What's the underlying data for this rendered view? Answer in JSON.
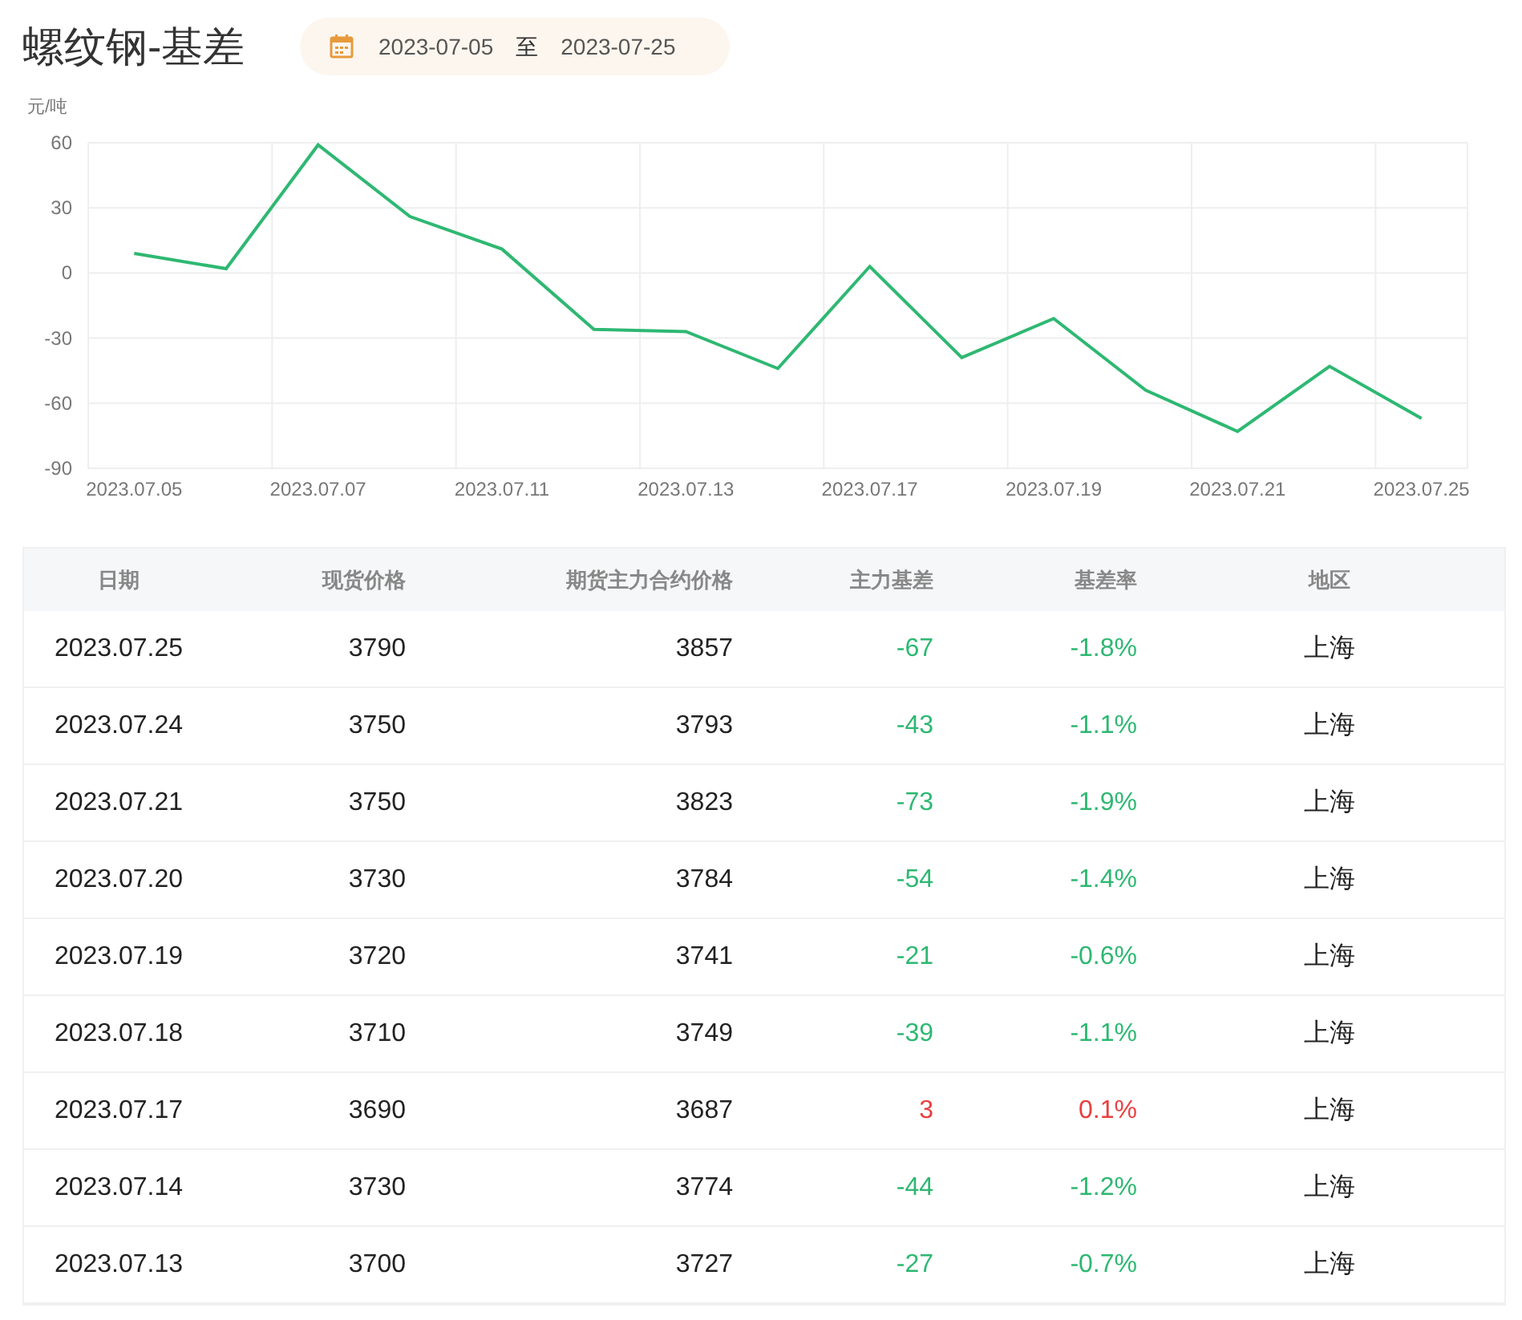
{
  "title": "螺纹钢-基差",
  "date_range": {
    "start": "2023-07-05",
    "separator": "至",
    "end": "2023-07-25"
  },
  "chart": {
    "chart_data": {
      "type": "line",
      "ylabel": "元/吨",
      "categories": [
        "2023.07.05",
        null,
        "2023.07.07",
        null,
        "2023.07.11",
        null,
        "2023.07.13",
        null,
        "2023.07.17",
        null,
        "2023.07.19",
        null,
        "2023.07.21",
        null,
        "2023.07.25"
      ],
      "grid": true,
      "yticks": [
        60,
        30,
        0,
        -30,
        -60,
        -90
      ],
      "ylim": [
        -90,
        60
      ],
      "series": [
        {
          "color": "#2eb872",
          "values": [
            9,
            2,
            59,
            26,
            11,
            -26,
            -27,
            -44,
            3,
            -39,
            -21,
            -54,
            -73,
            -43,
            -67
          ]
        }
      ]
    }
  },
  "table": {
    "columns": [
      "日期",
      "现货价格",
      "期货主力合约价格",
      "主力基差",
      "基差率",
      "地区"
    ],
    "rows": [
      {
        "date": "2023.07.25",
        "spot": "3790",
        "futures": "3857",
        "basis": "-67",
        "rate": "-1.8%",
        "region": "上海",
        "color": "#2eb872"
      },
      {
        "date": "2023.07.24",
        "spot": "3750",
        "futures": "3793",
        "basis": "-43",
        "rate": "-1.1%",
        "region": "上海",
        "color": "#2eb872"
      },
      {
        "date": "2023.07.21",
        "spot": "3750",
        "futures": "3823",
        "basis": "-73",
        "rate": "-1.9%",
        "region": "上海",
        "color": "#2eb872"
      },
      {
        "date": "2023.07.20",
        "spot": "3730",
        "futures": "3784",
        "basis": "-54",
        "rate": "-1.4%",
        "region": "上海",
        "color": "#2eb872"
      },
      {
        "date": "2023.07.19",
        "spot": "3720",
        "futures": "3741",
        "basis": "-21",
        "rate": "-0.6%",
        "region": "上海",
        "color": "#2eb872"
      },
      {
        "date": "2023.07.18",
        "spot": "3710",
        "futures": "3749",
        "basis": "-39",
        "rate": "-1.1%",
        "region": "上海",
        "color": "#2eb872"
      },
      {
        "date": "2023.07.17",
        "spot": "3690",
        "futures": "3687",
        "basis": "3",
        "rate": "0.1%",
        "region": "上海",
        "color": "#e94040"
      },
      {
        "date": "2023.07.14",
        "spot": "3730",
        "futures": "3774",
        "basis": "-44",
        "rate": "-1.2%",
        "region": "上海",
        "color": "#2eb872"
      },
      {
        "date": "2023.07.13",
        "spot": "3700",
        "futures": "3727",
        "basis": "-27",
        "rate": "-0.7%",
        "region": "上海",
        "color": "#2eb872"
      }
    ]
  }
}
